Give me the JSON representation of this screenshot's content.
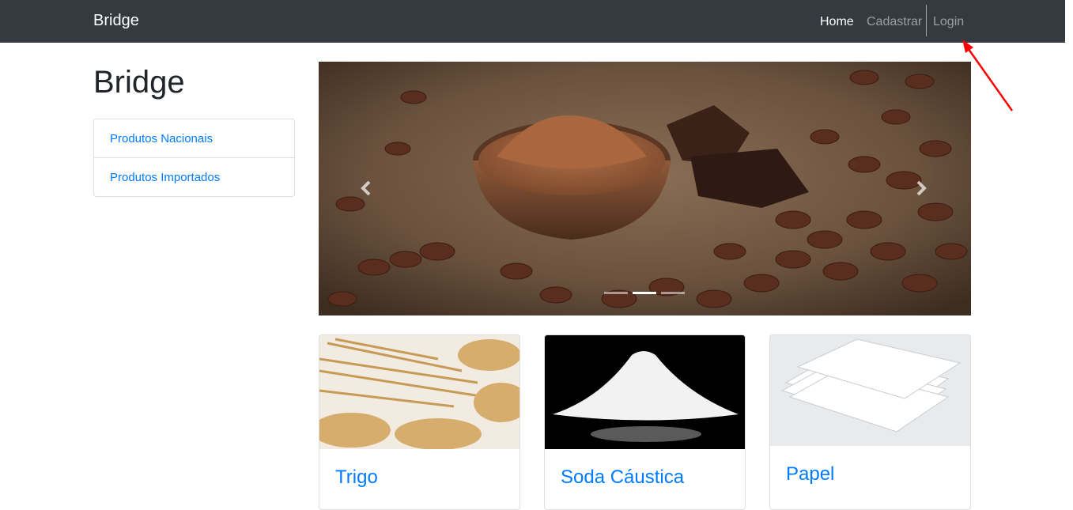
{
  "navbar": {
    "brand": "Bridge",
    "links": [
      {
        "label": "Home",
        "active": true
      },
      {
        "label": "Cadastrar",
        "active": false
      },
      {
        "label": "Login",
        "active": false
      }
    ]
  },
  "sidebar": {
    "title": "Bridge",
    "items": [
      {
        "label": "Produtos Nacionais"
      },
      {
        "label": "Produtos Importados"
      }
    ]
  },
  "carousel": {
    "slide_subject": "cocoa powder bowl with cocoa beans and chocolate",
    "indicator_count": 3,
    "active_index": 1,
    "prev_icon": "chevron-left-icon",
    "next_icon": "chevron-right-icon"
  },
  "products": [
    {
      "title": "Trigo",
      "image_subject": "wheat"
    },
    {
      "title": "Soda Cáustica",
      "image_subject": "white powder"
    },
    {
      "title": "Papel",
      "image_subject": "paper stack"
    }
  ],
  "colors": {
    "navbar_bg": "#343a40",
    "link": "#007bff",
    "annotation_arrow": "#ff0000"
  }
}
